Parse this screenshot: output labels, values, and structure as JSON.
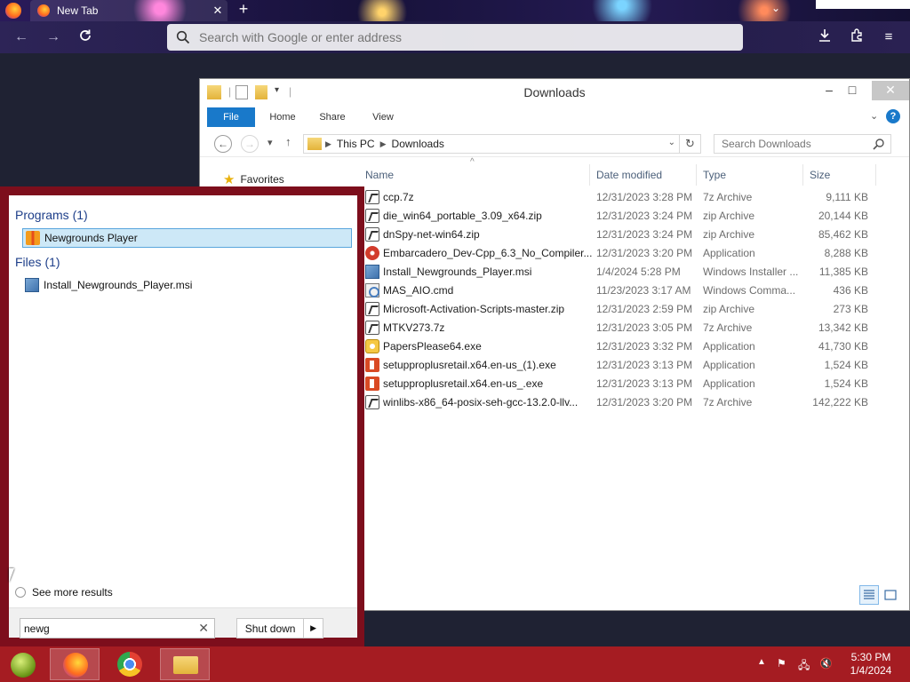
{
  "browser": {
    "tab_title": "New Tab",
    "tab_close": "✕",
    "new_tab": "+",
    "url_placeholder": "Search with Google or enter address"
  },
  "explorer": {
    "title": "Downloads",
    "ribbon": {
      "file": "File",
      "home": "Home",
      "share": "Share",
      "view": "View",
      "help": "?"
    },
    "breadcrumb": [
      "This PC",
      "Downloads"
    ],
    "search_placeholder": "Search Downloads",
    "nav": {
      "favorites": "Favorites"
    },
    "columns": {
      "name": "Name",
      "date": "Date modified",
      "type": "Type",
      "size": "Size"
    },
    "files": [
      {
        "name": "ccp.7z",
        "date": "12/31/2023 3:28 PM",
        "type": "7z Archive",
        "size": "9,111 KB",
        "icon": "archive-icon"
      },
      {
        "name": "die_win64_portable_3.09_x64.zip",
        "date": "12/31/2023 3:24 PM",
        "type": "zip Archive",
        "size": "20,144 KB",
        "icon": "archive-icon"
      },
      {
        "name": "dnSpy-net-win64.zip",
        "date": "12/31/2023 3:24 PM",
        "type": "zip Archive",
        "size": "85,462 KB",
        "icon": "archive-icon"
      },
      {
        "name": "Embarcadero_Dev-Cpp_6.3_No_Compiler...",
        "date": "12/31/2023 3:20 PM",
        "type": "Application",
        "size": "8,288 KB",
        "icon": "devcpp-icon"
      },
      {
        "name": "Install_Newgrounds_Player.msi",
        "date": "1/4/2024 5:28 PM",
        "type": "Windows Installer ...",
        "size": "11,385 KB",
        "icon": "installer-icon"
      },
      {
        "name": "MAS_AIO.cmd",
        "date": "11/23/2023 3:17 AM",
        "type": "Windows Comma...",
        "size": "436 KB",
        "icon": "cmd-icon"
      },
      {
        "name": "Microsoft-Activation-Scripts-master.zip",
        "date": "12/31/2023 2:59 PM",
        "type": "zip Archive",
        "size": "273 KB",
        "icon": "archive-icon"
      },
      {
        "name": "MTKV273.7z",
        "date": "12/31/2023 3:05 PM",
        "type": "7z Archive",
        "size": "13,342 KB",
        "icon": "archive-icon"
      },
      {
        "name": "PapersPlease64.exe",
        "date": "12/31/2023 3:32 PM",
        "type": "Application",
        "size": "41,730 KB",
        "icon": "papers-please-icon"
      },
      {
        "name": "setupproplusretail.x64.en-us_(1).exe",
        "date": "12/31/2023 3:13 PM",
        "type": "Application",
        "size": "1,524 KB",
        "icon": "office-icon"
      },
      {
        "name": "setupproplusretail.x64.en-us_.exe",
        "date": "12/31/2023 3:13 PM",
        "type": "Application",
        "size": "1,524 KB",
        "icon": "office-icon"
      },
      {
        "name": "winlibs-x86_64-posix-seh-gcc-13.2.0-llv...",
        "date": "12/31/2023 3:20 PM",
        "type": "7z Archive",
        "size": "142,222 KB",
        "icon": "archive-icon"
      }
    ]
  },
  "start_menu": {
    "programs_header": "Programs (1)",
    "program_item": "Newgrounds Player",
    "files_header": "Files (1)",
    "file_item": "Install_Newgrounds_Player.msi",
    "see_more": "See more results",
    "search_value": "newg",
    "shutdown_label": "Shut down"
  },
  "taskbar": {
    "time": "5:30 PM",
    "date": "1/4/2024"
  },
  "colors": {
    "accent": "#1979ca",
    "start_menu_frame": "#7d0e1c",
    "taskbar": "#a51c22",
    "selection": "#cde8f7"
  }
}
